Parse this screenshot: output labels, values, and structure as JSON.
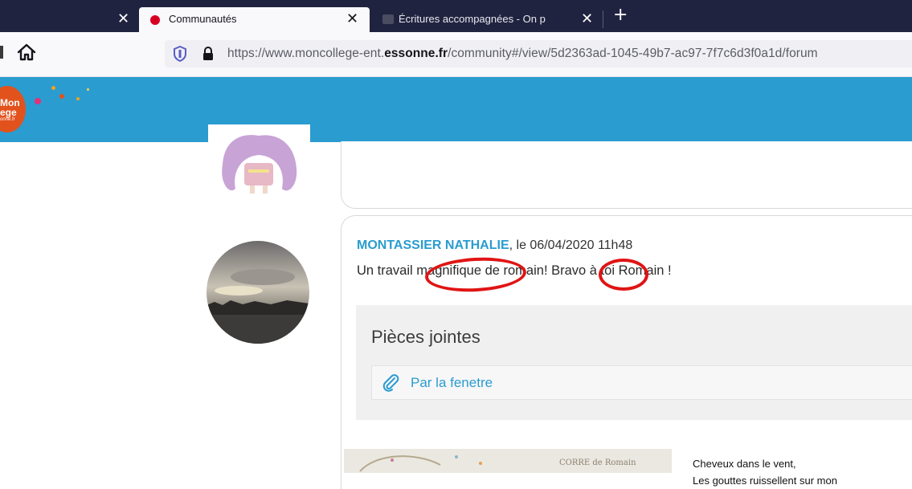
{
  "browser": {
    "tabs": [
      {
        "title": "Communautés",
        "active": true
      },
      {
        "title": "Écritures accompagnées - On p",
        "active": false
      }
    ],
    "close_glyph": "✕",
    "new_tab_glyph": "+",
    "url": {
      "prefix": "https://www.moncollege-ent.",
      "domain": "essonne.fr",
      "suffix": "/community#/view/5d2363ad-1045-49b7-ac97-7f7c6d3f0a1d/forum"
    }
  },
  "app": {
    "logo_line1": "Mon",
    "logo_line2": "ege",
    "logo_line3": "onne.fr",
    "header_color": "#2a9ccf"
  },
  "post": {
    "author": "MONTASSIER NATHALIE",
    "date_sep": ", le ",
    "date": "06/04/2020 11h48",
    "comment": "Un travail magnifique de romain! Bravo à toi Romain !",
    "attachments_title": "Pièces jointes",
    "attachments": [
      {
        "name": "Par la fenetre",
        "icon": "paperclip-icon"
      }
    ]
  },
  "poem": {
    "line1": "Cheveux dans le vent,",
    "line2": "Les gouttes ruissellent sur mon"
  },
  "image_caption": "CORRE de Romain",
  "colors": {
    "annotation": "#e01414",
    "link": "#2a9ccf",
    "tab_dot": "#d70022"
  }
}
